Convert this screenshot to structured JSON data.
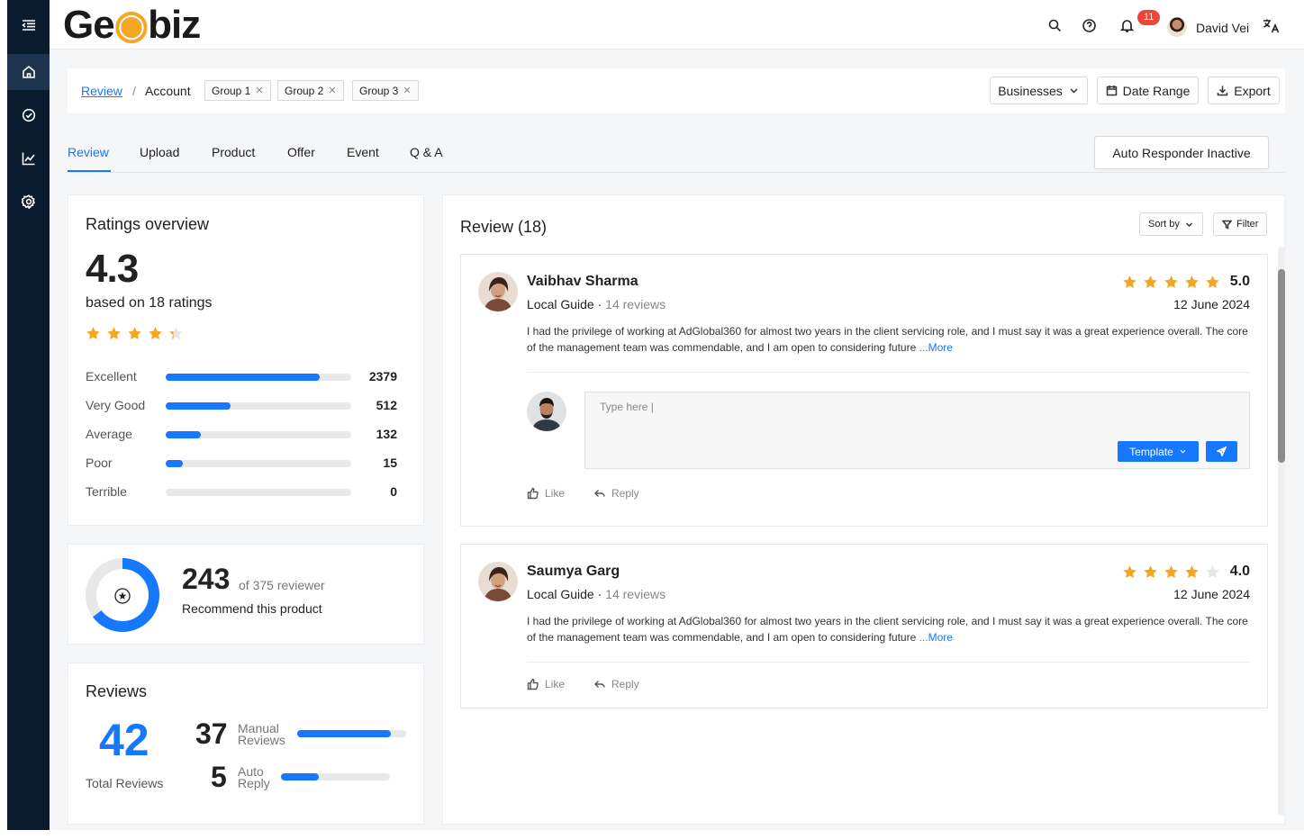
{
  "app": {
    "logo_text_a": "Ge",
    "logo_text_b": "biz",
    "notifications_count": "11",
    "user_name": "David Vei",
    "accent_color": "#1677ff",
    "star_color": "#f5a623",
    "sidebar_color": "#0b1b2e"
  },
  "sidebar": {
    "items": [
      {
        "icon": "menu-collapse-icon"
      },
      {
        "icon": "home-icon",
        "active": true
      },
      {
        "icon": "check-circle-icon"
      },
      {
        "icon": "chart-line-icon"
      },
      {
        "icon": "gear-icon"
      }
    ]
  },
  "breadcrumb": {
    "review": "Review",
    "separator": "/",
    "account": "Account",
    "chips": [
      "Group 1",
      "Group 2",
      "Group 3"
    ],
    "businesses": "Businesses",
    "date_range": "Date Range",
    "export": "Export"
  },
  "tabs": {
    "items": [
      "Review",
      "Upload",
      "Product",
      "Offer",
      "Event",
      "Q & A"
    ],
    "active": "Review",
    "auto_responder": "Auto Responder Inactive"
  },
  "ratings": {
    "title": "Ratings overview",
    "average": "4.3",
    "based_on": "based on 18 ratings",
    "average_value": 4.3,
    "rows": [
      {
        "label": "Excellent",
        "count": "2379",
        "fraction": 0.83
      },
      {
        "label": "Very Good",
        "count": "512",
        "fraction": 0.35
      },
      {
        "label": "Average",
        "count": "132",
        "fraction": 0.19
      },
      {
        "label": "Poor",
        "count": "15",
        "fraction": 0.09
      },
      {
        "label": "Terrible",
        "count": "0",
        "fraction": 0
      }
    ]
  },
  "recommend": {
    "count": "243",
    "of_text": "of 375 reviewer",
    "label": "Recommend this product",
    "fraction": 0.648
  },
  "reviews_summary": {
    "title": "Reviews",
    "total": "42",
    "total_label": "Total Reviews",
    "manual_count": "37",
    "manual_label_1": "Manual",
    "manual_label_2": "Reviews",
    "manual_fraction": 0.86,
    "auto_count": "5",
    "auto_label_1": "Auto",
    "auto_label_2": "Reply",
    "auto_fraction": 0.35
  },
  "review_list": {
    "title": "Review (18)",
    "sort_by": "Sort by",
    "filter": "Filter",
    "items": [
      {
        "name": "Vaibhav Sharma",
        "guide": "Local Guide",
        "reviews": "14 reviews",
        "score": "5.0",
        "rating": 5,
        "date": "12 June 2024",
        "text": "I had the privilege of working at AdGlobal360 for almost two years in the client servicing role, and I must say it was a great experience overall. The core of the management team was commendable, and I am open to considering future ",
        "more": "...More",
        "like": "Like",
        "reply": "Reply",
        "reply_placeholder": "Type here |",
        "template": "Template"
      },
      {
        "name": "Saumya Garg",
        "guide": "Local Guide",
        "reviews": "14 reviews",
        "score": "4.0",
        "rating": 4,
        "date": "12 June 2024",
        "text": "I had the privilege of working at AdGlobal360 for almost two years in the client servicing role, and I must say it was a great experience overall. The core of the management team was commendable, and I am open to considering future ",
        "more": "...More",
        "like": "Like",
        "reply": "Reply"
      }
    ]
  }
}
